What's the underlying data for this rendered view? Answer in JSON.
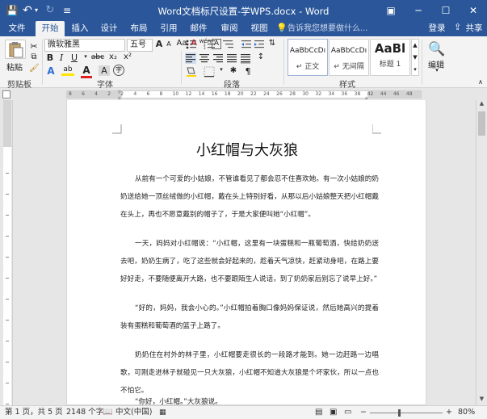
{
  "window": {
    "title": "Word文档标尺设置-学WPS.docx - Word",
    "accent": "#2b579a"
  },
  "qat": {
    "save": "💾",
    "undo": "↶",
    "undo_arrow": "▾",
    "redo": "↻",
    "customize": "≡"
  },
  "winbtns": {
    "ribbon_opts": "▣",
    "minimize": "─",
    "maximize": "☐",
    "close": "✕"
  },
  "tabs": [
    "文件",
    "开始",
    "插入",
    "设计",
    "布局",
    "引用",
    "邮件",
    "审阅",
    "视图"
  ],
  "active_tab": "开始",
  "tell_me": "告诉我您想要做什么...",
  "account": {
    "login": "登录",
    "share": "共享"
  },
  "ribbon": {
    "clipboard": {
      "paste": "粘贴",
      "label": "剪贴板"
    },
    "font": {
      "name": "微软雅黑",
      "size": "五号",
      "grow": "A",
      "shrink": "A",
      "aa": "Aa",
      "clear": "A",
      "phon": "wén",
      "border_char": "A",
      "bold": "B",
      "italic": "I",
      "underline": "U",
      "strike": "abc",
      "sub": "x₂",
      "sup": "x²",
      "effects": "A",
      "highlight": "ab",
      "font_color": "A",
      "shade": "A",
      "circle": "字",
      "label": "字体"
    },
    "paragraph": {
      "label": "段落"
    },
    "styles": {
      "items": [
        {
          "sample": "AaBbCcDı",
          "name": "↵ 正文"
        },
        {
          "sample": "AaBbCcDı",
          "name": "↵ 无间隔"
        },
        {
          "sample": "AaBl",
          "name": "标题 1"
        }
      ],
      "label": "样式"
    },
    "editing": {
      "label": "编辑"
    }
  },
  "ruler": {
    "h_numbers": [
      "8",
      "6",
      "4",
      "2",
      "2",
      "4",
      "6",
      "8",
      "10",
      "12",
      "14",
      "16",
      "18",
      "20",
      "22",
      "24",
      "26",
      "28",
      "30",
      "32",
      "34",
      "36",
      "38",
      "42",
      "44",
      "46",
      "48"
    ]
  },
  "document": {
    "title": "小红帽与大灰狼",
    "paragraphs": [
      "从前有一个可爱的小姑娘，不管谁看见了都会忍不住喜欢她。有一次小姑娘的奶奶送给她一顶丝绒做的小红帽，戴在头上特别好看，从那以后小姑娘整天把小红帽戴在头上，再也不愿意戴别的帽子了，于是大家便叫她“小红帽”。",
      "一天，妈妈对小红帽说：“小红帽，这里有一块蛋糕和一瓶葡萄酒，快给奶奶送去吧，奶奶生病了，吃了这些就会好起来的，趁着天气凉快，赶紧动身吧，在路上要好好走，不要随便离开大路，也不要跟陌生人说话，到了奶奶家后别忘了说早上好。”",
      "“好的，妈妈，我会小心的。”小红帽拍着胸口像妈妈保证说，然后她高兴的提着装有蛋糕和葡萄酒的篮子上路了。",
      "奶奶住在村外的林子里，小红帽要走很长的一段路才能到。她一边赶路一边唱歌，可刚走进林子就碰见一只大灰狼，小红帽不知道大灰狼是个坏家伙，所以一点也不怕它。",
      "“你好，小红帽。”大灰狼说。"
    ]
  },
  "status": {
    "page": "第 1 页，共 5 页",
    "words": "2148 个字",
    "lang": "中文(中国)",
    "zoom": "80%",
    "zoom_fraction": 0.8
  }
}
